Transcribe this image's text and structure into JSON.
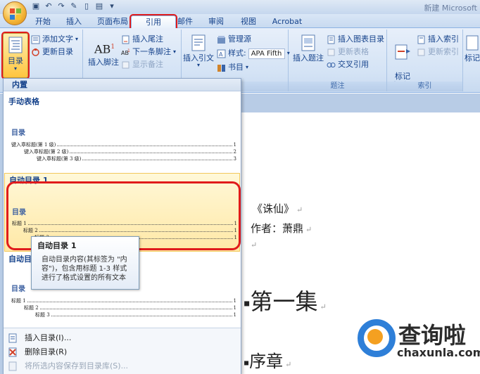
{
  "app": {
    "title": "新建 Microsoft"
  },
  "tabs": [
    {
      "label": "开始"
    },
    {
      "label": "插入"
    },
    {
      "label": "页面布局"
    },
    {
      "label": "引用"
    },
    {
      "label": "邮件"
    },
    {
      "label": "审阅"
    },
    {
      "label": "视图"
    },
    {
      "label": "Acrobat"
    }
  ],
  "active_tab": "引用",
  "ribbon": {
    "toc": {
      "toc_button": "目录",
      "add_text": "添加文字",
      "update_toc": "更新目录"
    },
    "footnotes": {
      "insert_footnote": "插入脚注",
      "insert_endnote": "插入尾注",
      "next_footnote": "下一条脚注",
      "show_notes": "显示备注"
    },
    "citations": {
      "label": "书目",
      "insert_citation": "插入引文",
      "manage_sources": "管理源",
      "style_label": "样式:",
      "style_value": "APA Fifth",
      "bibliography": "书目"
    },
    "captions": {
      "label": "题注",
      "insert_caption": "插入题注",
      "insert_table_of_figures": "插入图表目录",
      "update_table": "更新表格",
      "cross_reference": "交叉引用"
    },
    "index": {
      "label": "索引",
      "mark_entry": "标记\n索引项",
      "insert_index": "插入索引",
      "update_index": "更新索引"
    },
    "tables_of_authorities": {
      "mark_citation": "标记"
    }
  },
  "dropdown": {
    "header": "内置",
    "entries": [
      {
        "title": "手动表格",
        "heading": "目录",
        "lines": [
          {
            "text": "键入章标题(第 1 级)",
            "page": "1"
          },
          {
            "text": "键入章标题(第 2 级)",
            "page": "2"
          },
          {
            "text": "键入章标题(第 3 级)",
            "page": "3"
          }
        ]
      },
      {
        "title": "自动目录 1",
        "heading": "目录",
        "lines": [
          {
            "text": "标题 1",
            "page": "1"
          },
          {
            "text": "标题 2",
            "page": "1"
          },
          {
            "text": "标题 3",
            "page": "1"
          }
        ]
      },
      {
        "title": "自动目录 2",
        "heading": "目录",
        "lines": [
          {
            "text": "标题 1",
            "page": "1"
          },
          {
            "text": "标题 2",
            "page": "1"
          },
          {
            "text": "标题 3",
            "page": "1"
          }
        ]
      }
    ],
    "tooltip": {
      "title": "自动目录 1",
      "body": "自动目录内容(其标签为 \"内容\")，包含用标题 1-3 样式进行了格式设置的所有文本"
    },
    "menu_items": [
      {
        "label": "插入目录(I)..."
      },
      {
        "label": "删除目录(R)"
      },
      {
        "label": "将所选内容保存到目录库(S)..."
      }
    ]
  },
  "document": {
    "line1": "《诛仙》",
    "line2": "作者：萧鼎",
    "heading1": "第一集",
    "heading2": "序章"
  },
  "watermark": {
    "text": "查询啦",
    "url": "chaxunla.com"
  }
}
